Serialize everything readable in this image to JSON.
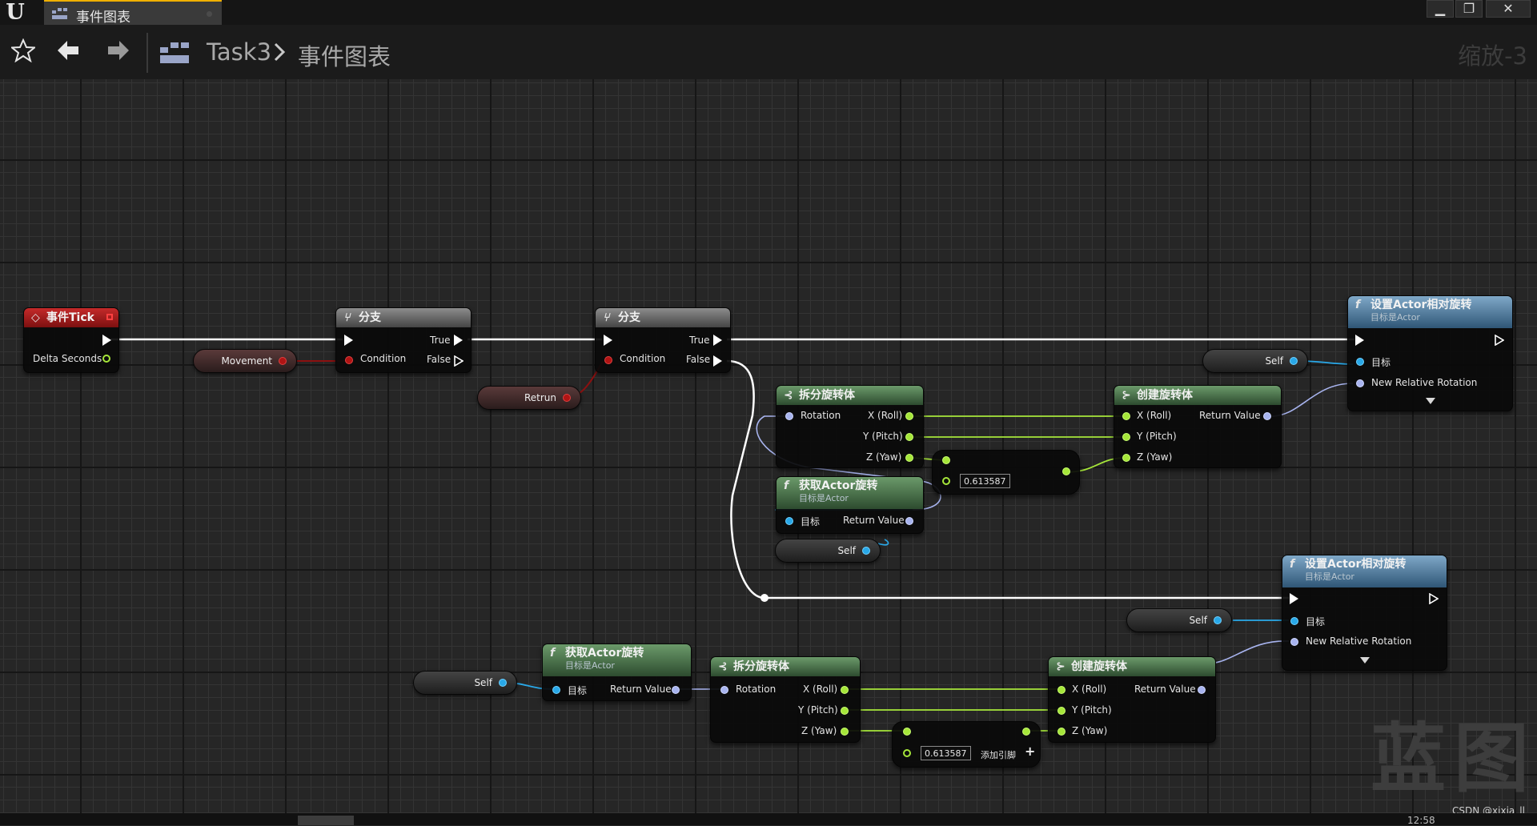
{
  "window": {
    "tab_label": "事件图表",
    "minimize_glyph": "▁",
    "maximize_glyph": "❐",
    "close_glyph": "✕"
  },
  "toolbar": {
    "breadcrumb_root": "Task3",
    "breadcrumb_leaf": "事件图表",
    "zoom_label": "缩放-3"
  },
  "nodes": {
    "event_tick": {
      "title": "事件Tick",
      "pin_delta": "Delta Seconds"
    },
    "var_movement": {
      "label": "Movement"
    },
    "branch1": {
      "title": "分支",
      "pin_condition": "Condition",
      "pin_true": "True",
      "pin_false": "False"
    },
    "var_retrun": {
      "label": "Retrun"
    },
    "branch2": {
      "title": "分支",
      "pin_condition": "Condition",
      "pin_true": "True",
      "pin_false": "False"
    },
    "break_rot1": {
      "title": "拆分旋转体",
      "pin_in": "Rotation",
      "pin_x": "X (Roll)",
      "pin_y": "Y (Pitch)",
      "pin_z": "Z (Yaw)"
    },
    "get_rot1": {
      "title": "获取Actor旋转",
      "subtitle": "目标是Actor",
      "pin_target": "目标",
      "pin_ret": "Return Value"
    },
    "self1": {
      "label": "Self"
    },
    "add1": {
      "value": "0.613587"
    },
    "make_rot1": {
      "title": "创建旋转体",
      "pin_x": "X (Roll)",
      "pin_y": "Y (Pitch)",
      "pin_z": "Z (Yaw)",
      "pin_ret": "Return Value"
    },
    "set_rot1": {
      "title": "设置Actor相对旋转",
      "subtitle": "目标是Actor",
      "pin_target": "目标",
      "pin_rotation": "New Relative Rotation"
    },
    "self_set1": {
      "label": "Self"
    },
    "set_rot2": {
      "title": "设置Actor相对旋转",
      "subtitle": "目标是Actor",
      "pin_target": "目标",
      "pin_rotation": "New Relative Rotation"
    },
    "self_set2": {
      "label": "Self"
    },
    "self2": {
      "label": "Self"
    },
    "get_rot2": {
      "title": "获取Actor旋转",
      "subtitle": "目标是Actor",
      "pin_target": "目标",
      "pin_ret": "Return Value"
    },
    "break_rot2": {
      "title": "拆分旋转体",
      "pin_in": "Rotation",
      "pin_x": "X (Roll)",
      "pin_y": "Y (Pitch)",
      "pin_z": "Z (Yaw)"
    },
    "add2": {
      "value": "0.613587",
      "add_pin_label": "添加引脚"
    },
    "make_rot2": {
      "title": "创建旋转体",
      "pin_x": "X (Roll)",
      "pin_y": "Y (Pitch)",
      "pin_z": "Z (Yaw)",
      "pin_ret": "Return Value"
    }
  },
  "watermark": "蓝图",
  "credit": "CSDN @xixia_ll",
  "status_text": "12:58",
  "colors": {
    "exec_wire": "#ffffff",
    "float_wire": "#a6e63a",
    "rotator_wire": "#a8b4ef",
    "object_wire": "#29a8e8",
    "bool_wire": "#8c1010",
    "tab_accent": "#f0b000"
  },
  "icons": [
    "unreal-logo-icon",
    "graph-icon",
    "star-icon",
    "back-arrow-icon",
    "forward-arrow-icon",
    "chevron-right-icon",
    "function-icon",
    "branch-icon",
    "break-struct-icon",
    "make-struct-icon",
    "event-icon"
  ]
}
